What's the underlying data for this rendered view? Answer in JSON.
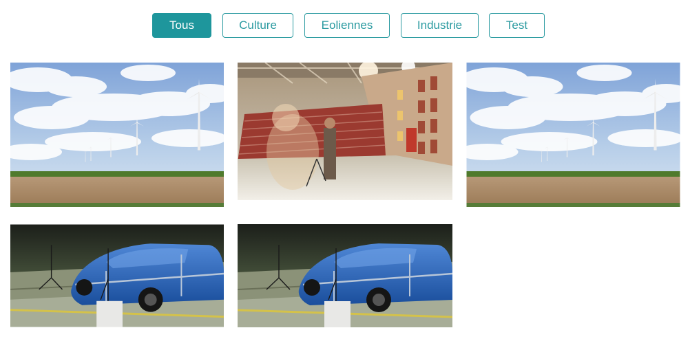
{
  "filters": {
    "items": [
      {
        "label": "Tous",
        "active": true
      },
      {
        "label": "Culture",
        "active": false
      },
      {
        "label": "Eoliennes",
        "active": false
      },
      {
        "label": "Industrie",
        "active": false
      },
      {
        "label": "Test",
        "active": false
      }
    ]
  },
  "gallery": {
    "items": [
      {
        "category": "Eoliennes",
        "icon": "wind-turbines-photo"
      },
      {
        "category": "Culture",
        "icon": "theater-stage-photo"
      },
      {
        "category": "Eoliennes",
        "icon": "wind-turbines-photo"
      },
      {
        "category": "Industrie",
        "icon": "car-wind-tunnel-photo"
      },
      {
        "category": "Test",
        "icon": "car-wind-tunnel-photo"
      }
    ]
  },
  "colors": {
    "accent": "#1e969c",
    "border": "#2a9aa0"
  }
}
